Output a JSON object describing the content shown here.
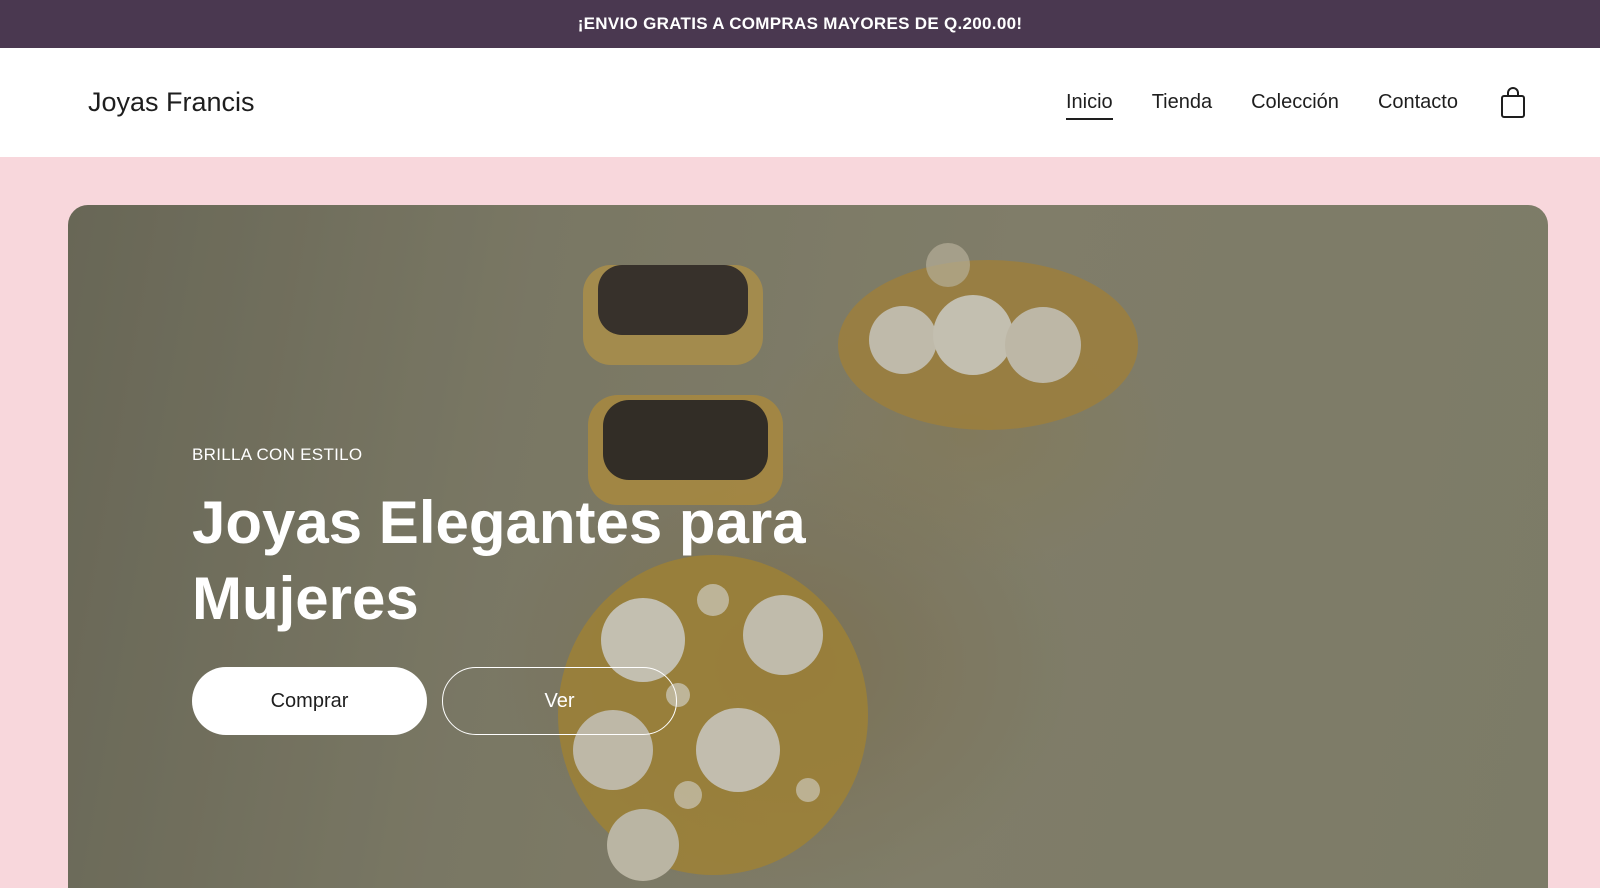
{
  "announcement": {
    "text": "¡ENVIO GRATIS A COMPRAS MAYORES DE Q.200.00!"
  },
  "header": {
    "brand": "Joyas Francis",
    "nav": [
      {
        "label": "Inicio",
        "active": true
      },
      {
        "label": "Tienda",
        "active": false
      },
      {
        "label": "Colección",
        "active": false
      },
      {
        "label": "Contacto",
        "active": false
      }
    ],
    "cart_icon": "shopping-bag-icon"
  },
  "hero": {
    "eyebrow": "BRILLA CON ESTILO",
    "title": "Joyas Elegantes para Mujeres",
    "primary_button": "Comprar",
    "secondary_button": "Ver",
    "image": "gold-pearl-earrings-photo"
  },
  "colors": {
    "announcement_bg": "#4a3850",
    "page_bg": "#f8d7dc",
    "header_bg": "#ffffff",
    "text": "#1e1e1e"
  }
}
